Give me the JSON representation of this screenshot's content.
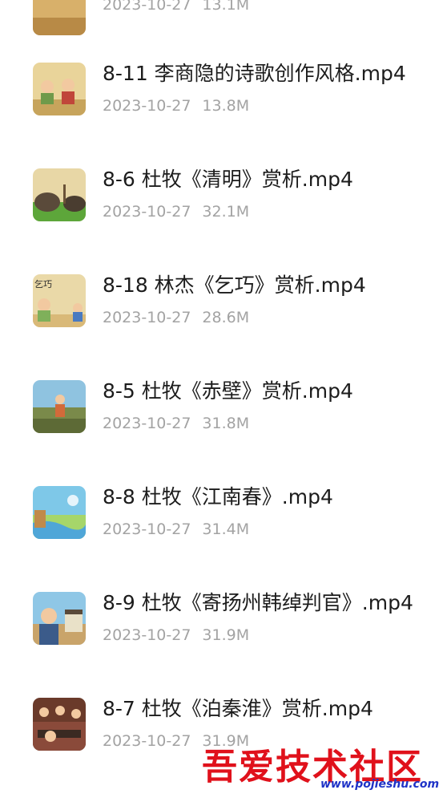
{
  "items": [
    {
      "title": "",
      "date": "2023-10-27",
      "size": "13.1M",
      "thumb": "partial-top"
    },
    {
      "title": "8-11 李商隐的诗歌创作风格.mp4",
      "date": "2023-10-27",
      "size": "13.8M",
      "thumb": "video-thumbnail"
    },
    {
      "title": "8-6 杜牧《清明》赏析.mp4",
      "date": "2023-10-27",
      "size": "32.1M",
      "thumb": "video-thumbnail"
    },
    {
      "title": "8-18 林杰《乞巧》赏析.mp4",
      "date": "2023-10-27",
      "size": "28.6M",
      "thumb": "video-thumbnail",
      "thumb_text": "乞巧"
    },
    {
      "title": "8-5 杜牧《赤壁》赏析.mp4",
      "date": "2023-10-27",
      "size": "31.8M",
      "thumb": "video-thumbnail"
    },
    {
      "title": "8-8 杜牧《江南春》.mp4",
      "date": "2023-10-27",
      "size": "31.4M",
      "thumb": "video-thumbnail"
    },
    {
      "title": "8-9 杜牧《寄扬州韩绰判官》.mp4",
      "date": "2023-10-27",
      "size": "31.9M",
      "thumb": "video-thumbnail"
    },
    {
      "title": "8-7 杜牧《泊秦淮》赏析.mp4",
      "date": "2023-10-27",
      "size": "31.9M",
      "thumb": "video-thumbnail"
    }
  ],
  "watermark": {
    "text": "吾爱技术社区",
    "url": "www.pojieshu.com"
  },
  "colors": {
    "title": "#1c1c1c",
    "meta": "#a3a3a3",
    "watermark_red": "#e0111b",
    "watermark_blue": "#1f33c7"
  }
}
